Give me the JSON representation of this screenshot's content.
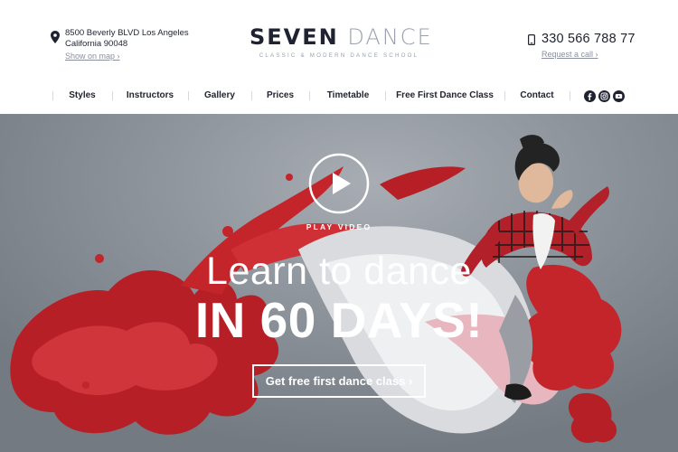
{
  "header": {
    "address": {
      "line1": "8500 Beverly BLVD Los Angeles",
      "line2": "California 90048",
      "map_link": "Show on map ›",
      "icon": "map-pin-icon"
    },
    "logo": {
      "word1": "SEVEN",
      "word2": "DANCE",
      "tagline": "CLASSIC & MODERN DANCE SCHOOL"
    },
    "phone": {
      "number": "330 566 788 77",
      "call_link": "Request a call ›",
      "icon": "phone-icon"
    }
  },
  "nav": {
    "items": [
      {
        "label": "Styles"
      },
      {
        "label": "Instructors"
      },
      {
        "label": "Gallery"
      },
      {
        "label": "Prices"
      },
      {
        "label": "Timetable"
      },
      {
        "label": "Free First Dance Class"
      },
      {
        "label": "Contact"
      }
    ],
    "social": [
      "facebook-icon",
      "instagram-icon",
      "youtube-icon"
    ]
  },
  "hero": {
    "play_label": "PLAY VIDEO",
    "headline_line1": "Learn to dance",
    "headline_line2": "IN 60 DAYS!",
    "cta_label": "Get free first dance class ›"
  },
  "colors": {
    "text_dark": "#1f2230",
    "text_muted": "#9aa0ad",
    "paint_red": "#c8252c",
    "hero_gray": "#8f959c"
  }
}
